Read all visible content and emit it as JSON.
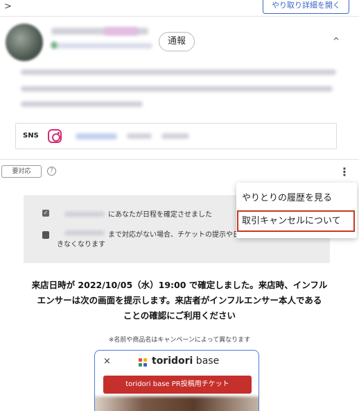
{
  "header": {
    "detail_button": "やり取り詳細を開く",
    "back_chevron": ">"
  },
  "profile": {
    "report_button": "通報",
    "collapse_icon": "^"
  },
  "sns": {
    "label": "SNS",
    "icon": "instagram-icon"
  },
  "status": {
    "tag": "要対応",
    "help": "?"
  },
  "notice": {
    "line1": "にあなたが日程を確定させました",
    "line2a": "まで対応がない場合、チケットの提示や日程",
    "line2b": "きなくなります"
  },
  "menu": {
    "items": [
      "やりとりの履歴を見る",
      "取引キャンセルについて"
    ]
  },
  "confirmation": {
    "lines": [
      "来店日時が 2022/10/05（水）19:00 で確定しました。来店時、インフル",
      "エンサーは次の画面を提示します。来店者がインフルエンサー本人である",
      "ことの確認にご利用ください"
    ],
    "note": "※名前や商品名はキャンペーンによって異なります"
  },
  "ticket": {
    "close": "×",
    "logo_bold": "toridori",
    "logo_light": " base",
    "banner": "toridori base PR投稿用チケット"
  },
  "colors": {
    "accent": "#3a66c4",
    "instagram": "#d42c76",
    "highlight": "#c8381f",
    "banner": "#c5302d"
  }
}
